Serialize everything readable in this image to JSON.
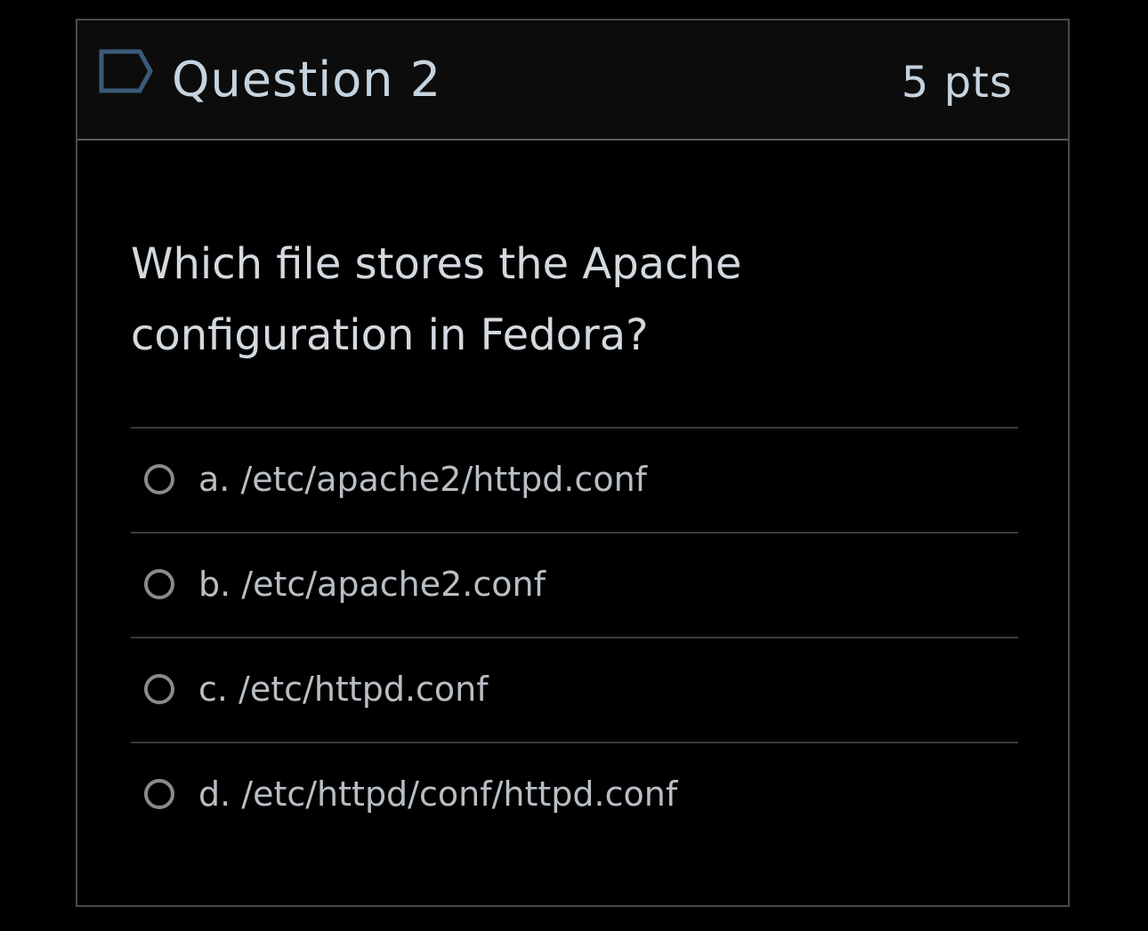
{
  "question": {
    "title": "Question 2",
    "points": "5 pts",
    "flag_icon": "flag-question-icon",
    "text": "Which file stores the Apache configuration in Fedora?"
  },
  "answers": [
    {
      "label": "a. /etc/apache2/httpd.conf",
      "selected": false
    },
    {
      "label": "b. /etc/apache2.conf",
      "selected": false
    },
    {
      "label": "c. /etc/httpd.conf",
      "selected": false
    },
    {
      "label": "d. /etc/httpd/conf/httpd.conf",
      "selected": false
    }
  ],
  "colors": {
    "background": "#000000",
    "header_background": "#0c0c0c",
    "title_text": "#c5d3df",
    "flag_stroke": "#3a5a78"
  }
}
